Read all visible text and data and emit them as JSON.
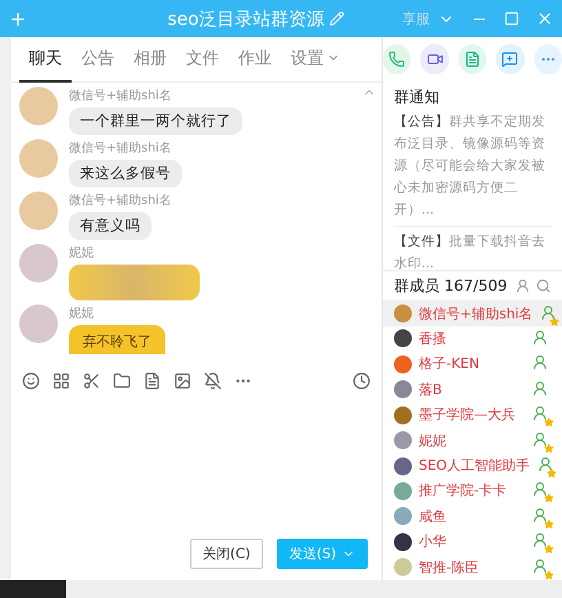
{
  "window": {
    "title": "seo泛目录站群资源",
    "account": "享服"
  },
  "tabs": [
    {
      "label": "聊天",
      "selected": true
    },
    {
      "label": "公告",
      "selected": false
    },
    {
      "label": "相册",
      "selected": false
    },
    {
      "label": "文件",
      "selected": false
    },
    {
      "label": "作业",
      "selected": false
    },
    {
      "label": "设置",
      "selected": false,
      "dropdown": true
    }
  ],
  "messages": [
    {
      "sender": "微信号+辅助shi名",
      "kind": "text",
      "text": "一个群里一两个就行了"
    },
    {
      "sender": "微信号+辅助shi名",
      "kind": "text",
      "text": "来这么多假号"
    },
    {
      "sender": "微信号+辅助shi名",
      "kind": "text",
      "text": "有意义吗"
    },
    {
      "sender": "妮妮",
      "kind": "blurred"
    },
    {
      "sender": "妮妮",
      "kind": "sticker",
      "text": "弃不聆飞了"
    }
  ],
  "notice": {
    "title": "群通知",
    "items": [
      {
        "tag": "【公告】",
        "text": "群共享不定期发布泛目录、镜像源码等资源（尽可能会给大家发被心未加密源码方便二开）..."
      },
      {
        "tag": "【文件】",
        "text": "批量下载抖音去水印..."
      }
    ]
  },
  "members": {
    "title": "群成员",
    "count": "167/509",
    "list": [
      {
        "name": "微信号+辅助shi名",
        "starred": true,
        "selected": true
      },
      {
        "name": "香搔",
        "starred": false,
        "selected": false
      },
      {
        "name": "格子-KEN",
        "starred": false,
        "selected": false
      },
      {
        "name": "落B",
        "starred": false,
        "selected": false
      },
      {
        "name": "墨子学院—大兵",
        "starred": true,
        "selected": false
      },
      {
        "name": "妮妮",
        "starred": true,
        "selected": false
      },
      {
        "name": "SEO人工智能助手",
        "starred": true,
        "selected": false
      },
      {
        "name": "推广学院-卡卡",
        "starred": true,
        "selected": false
      },
      {
        "name": "咸鱼",
        "starred": true,
        "selected": false
      },
      {
        "name": "小华",
        "starred": true,
        "selected": false
      },
      {
        "name": "智推-陈臣",
        "starred": true,
        "selected": false
      }
    ]
  },
  "buttons": {
    "close": "关闭(C)",
    "send": "发送(S)"
  }
}
